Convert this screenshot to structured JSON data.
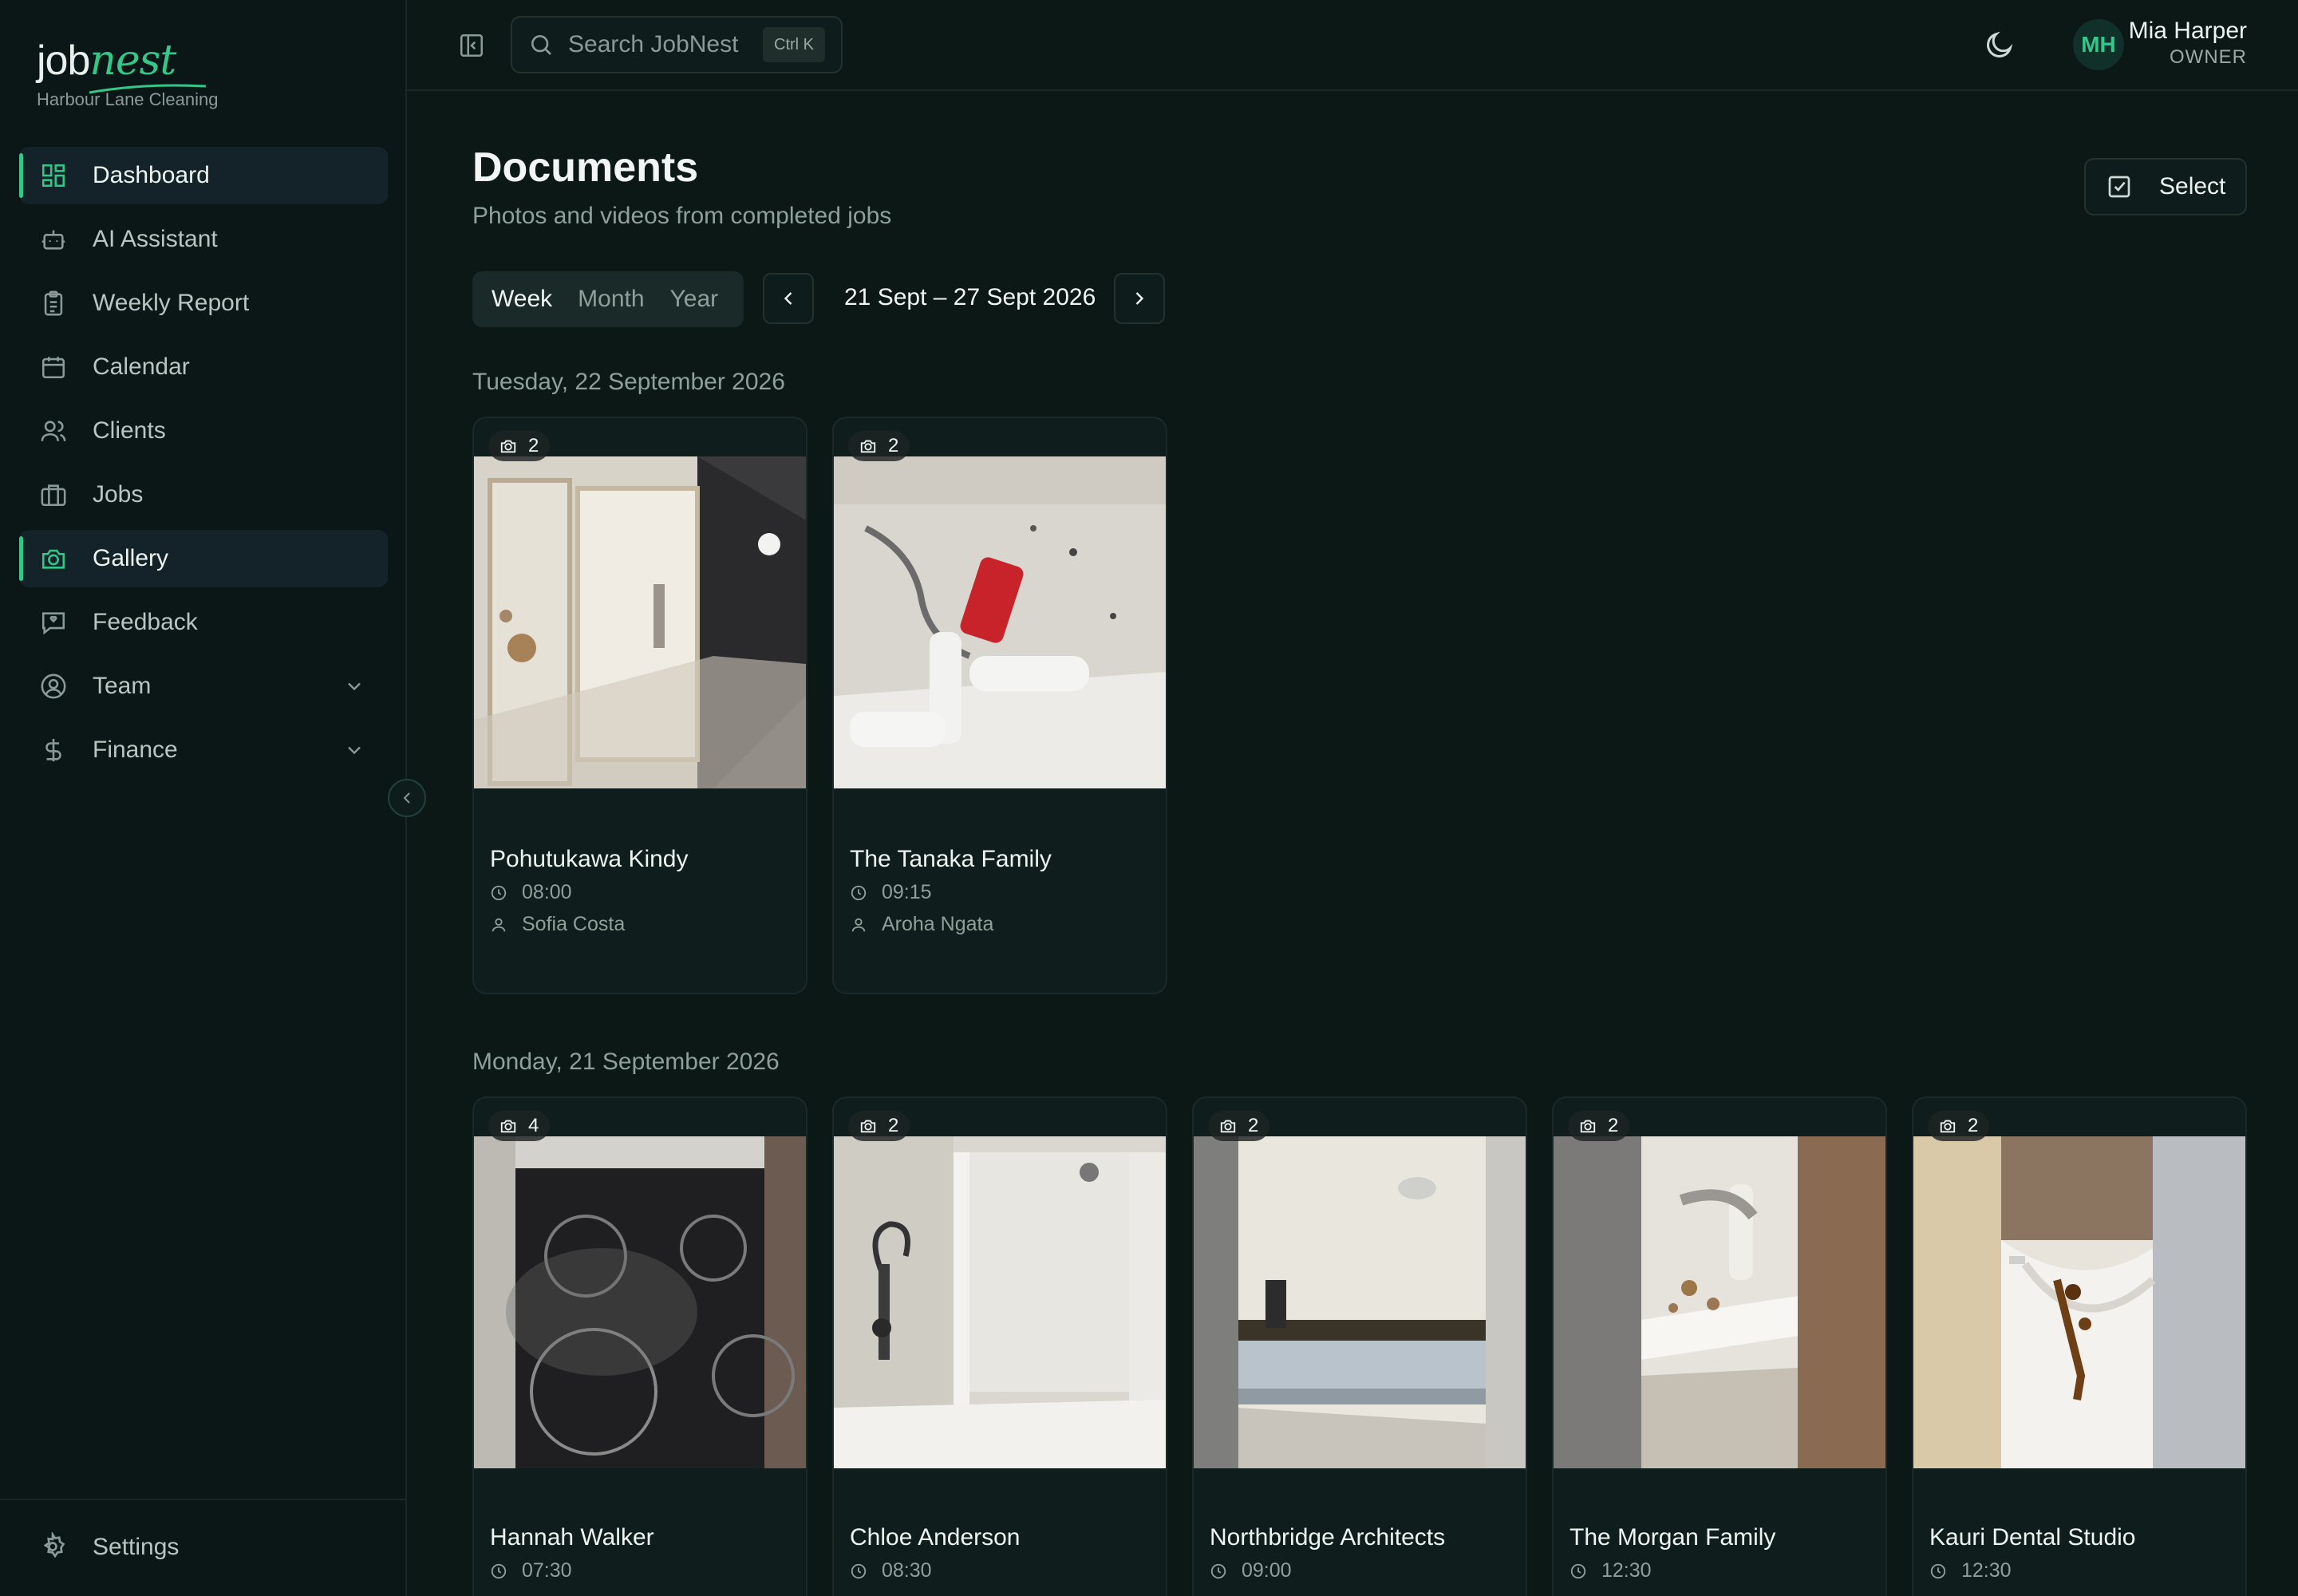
{
  "brand": {
    "logo_job": "job",
    "logo_nest": "nest",
    "org": "Harbour Lane Cleaning"
  },
  "nav": [
    {
      "label": "Dashboard",
      "icon": "dashboard-icon",
      "active": true
    },
    {
      "label": "AI Assistant",
      "icon": "robot-icon",
      "active": false
    },
    {
      "label": "Weekly Report",
      "icon": "clipboard-icon",
      "active": false
    },
    {
      "label": "Calendar",
      "icon": "calendar-icon",
      "active": false
    },
    {
      "label": "Clients",
      "icon": "users-icon",
      "active": false
    },
    {
      "label": "Jobs",
      "icon": "briefcase-icon",
      "active": false
    },
    {
      "label": "Gallery",
      "icon": "camera-icon",
      "active": true
    },
    {
      "label": "Feedback",
      "icon": "message-icon",
      "active": false
    },
    {
      "label": "Team",
      "icon": "user-circle-icon",
      "active": false,
      "expandable": true
    },
    {
      "label": "Finance",
      "icon": "dollar-icon",
      "active": false,
      "expandable": true
    }
  ],
  "settings_label": "Settings",
  "search": {
    "placeholder": "Search JobNest",
    "shortcut": "Ctrl K"
  },
  "user": {
    "initials": "MH",
    "name": "Mia Harper",
    "role": "OWNER"
  },
  "page": {
    "title": "Documents",
    "subtitle": "Photos and videos from completed jobs",
    "select_label": "Select"
  },
  "range": {
    "tabs": [
      "Week",
      "Month",
      "Year"
    ],
    "active": "Week",
    "label": "21 Sept – 27 Sept 2026"
  },
  "days": [
    {
      "heading": "Tuesday, 22 September 2026",
      "cards": [
        {
          "client": "Pohutukawa Kindy",
          "time": "08:00",
          "staff": "Sofia Costa",
          "count": "2"
        },
        {
          "client": "The Tanaka Family",
          "time": "09:15",
          "staff": "Aroha Ngata",
          "count": "2"
        }
      ]
    },
    {
      "heading": "Monday, 21 September 2026",
      "cards": [
        {
          "client": "Hannah Walker",
          "time": "07:30",
          "count": "4"
        },
        {
          "client": "Chloe Anderson",
          "time": "08:30",
          "count": "2"
        },
        {
          "client": "Northbridge Architects",
          "time": "09:00",
          "count": "2"
        },
        {
          "client": "The Morgan Family",
          "time": "12:30",
          "count": "2"
        },
        {
          "client": "Kauri Dental Studio",
          "time": "12:30",
          "count": "2"
        }
      ]
    }
  ],
  "colors": {
    "accent": "#35c68a",
    "background": "#0b1816",
    "sidebar": "#0b1717",
    "active_item": "#14232a"
  }
}
